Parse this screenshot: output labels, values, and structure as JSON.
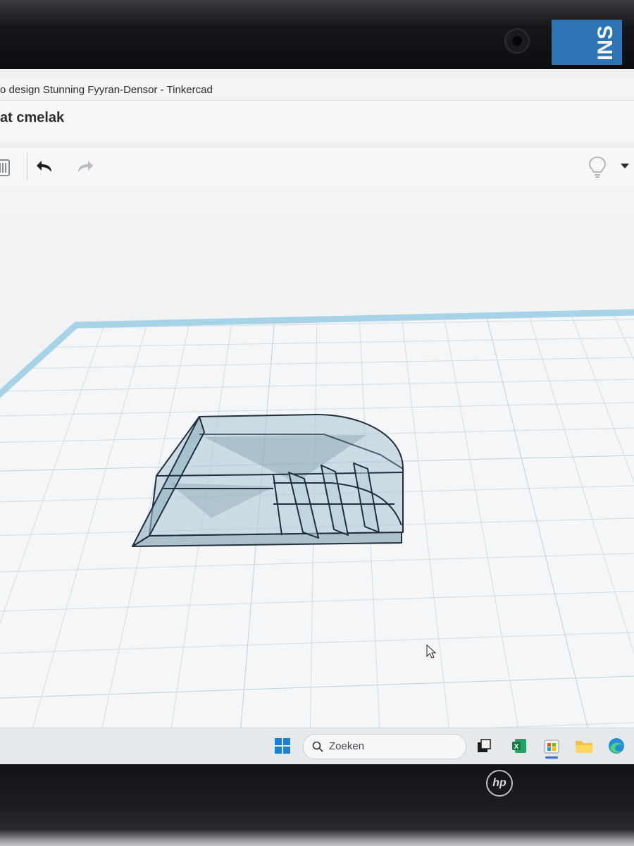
{
  "window": {
    "title": "o design Stunning Fyyran-Densor - Tinkercad"
  },
  "project": {
    "name": "at cmelak"
  },
  "toolbar": {
    "icons": [
      "trash-icon",
      "undo-icon",
      "redo-icon",
      "lightbulb-icon",
      "dropdown-icon"
    ]
  },
  "device": {
    "sticker_text": "INS",
    "brand": "hp"
  },
  "taskbar": {
    "search_placeholder": "Zoeken",
    "icons": [
      "windows-start-icon",
      "search-icon",
      "task-view-icon",
      "excel-icon",
      "store-icon",
      "file-explorer-icon",
      "edge-icon"
    ]
  },
  "colors": {
    "workplane_border": "#9fd0e6",
    "grid_line": "#c7d9e2",
    "model_fill": "#8fb1c2",
    "model_edge": "#1f2f3f",
    "sticker": "#2d74b4"
  }
}
